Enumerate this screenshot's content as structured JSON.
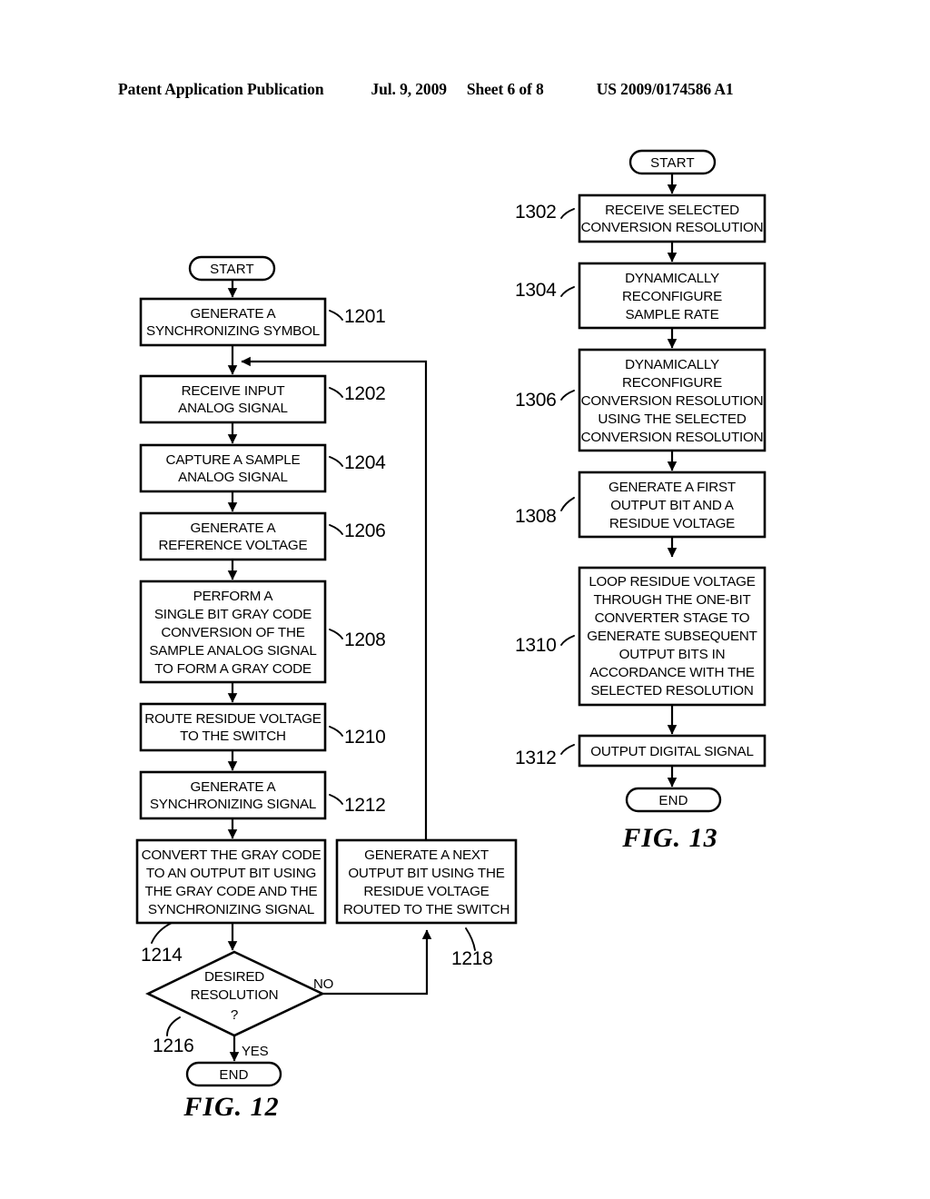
{
  "header": {
    "publication": "Patent Application Publication",
    "date": "Jul. 9, 2009",
    "sheet": "Sheet 6 of 8",
    "document_number": "US 2009/0174586 A1"
  },
  "fig12": {
    "caption": "FIG. 12",
    "start_label": "START",
    "end_label": "END",
    "branch_yes": "YES",
    "branch_no": "NO",
    "nodes": [
      {
        "ref": "1201",
        "lines": [
          "GENERATE A",
          "SYNCHRONIZING SYMBOL"
        ]
      },
      {
        "ref": "1202",
        "lines": [
          "RECEIVE INPUT",
          "ANALOG SIGNAL"
        ]
      },
      {
        "ref": "1204",
        "lines": [
          "CAPTURE A SAMPLE",
          "ANALOG SIGNAL"
        ]
      },
      {
        "ref": "1206",
        "lines": [
          "GENERATE A",
          "REFERENCE VOLTAGE"
        ]
      },
      {
        "ref": "1208",
        "lines": [
          "PERFORM A",
          "SINGLE BIT GRAY CODE",
          "CONVERSION OF THE",
          "SAMPLE ANALOG SIGNAL",
          "TO FORM A GRAY CODE"
        ]
      },
      {
        "ref": "1210",
        "lines": [
          "ROUTE RESIDUE VOLTAGE",
          "TO THE SWITCH"
        ]
      },
      {
        "ref": "1212",
        "lines": [
          "GENERATE A",
          "SYNCHRONIZING SIGNAL"
        ]
      },
      {
        "ref": "1214",
        "lines": [
          "CONVERT THE GRAY CODE",
          "TO AN OUTPUT BIT USING",
          "THE GRAY CODE AND THE",
          "SYNCHRONIZING SIGNAL"
        ]
      },
      {
        "ref": "1216",
        "lines": [
          "DESIRED",
          "RESOLUTION",
          "?"
        ]
      },
      {
        "ref": "1218",
        "lines": [
          "GENERATE A NEXT",
          "OUTPUT BIT USING THE",
          "RESIDUE VOLTAGE",
          "ROUTED TO THE SWITCH"
        ]
      }
    ]
  },
  "fig13": {
    "caption": "FIG. 13",
    "start_label": "START",
    "end_label": "END",
    "nodes": [
      {
        "ref": "1302",
        "lines": [
          "RECEIVE SELECTED",
          "CONVERSION RESOLUTION"
        ]
      },
      {
        "ref": "1304",
        "lines": [
          "DYNAMICALLY",
          "RECONFIGURE",
          "SAMPLE RATE"
        ]
      },
      {
        "ref": "1306",
        "lines": [
          "DYNAMICALLY",
          "RECONFIGURE",
          "CONVERSION RESOLUTION",
          "USING THE SELECTED",
          "CONVERSION RESOLUTION"
        ]
      },
      {
        "ref": "1308",
        "lines": [
          "GENERATE A FIRST",
          "OUTPUT BIT AND A",
          "RESIDUE VOLTAGE"
        ]
      },
      {
        "ref": "1310",
        "lines": [
          "LOOP RESIDUE VOLTAGE",
          "THROUGH THE ONE-BIT",
          "CONVERTER STAGE TO",
          "GENERATE SUBSEQUENT",
          "OUTPUT BITS IN",
          "ACCORDANCE WITH THE",
          "SELECTED RESOLUTION"
        ]
      },
      {
        "ref": "1312",
        "lines": [
          "OUTPUT DIGITAL SIGNAL"
        ]
      }
    ]
  },
  "colors": {
    "ink": "#000000",
    "paper": "#ffffff"
  }
}
